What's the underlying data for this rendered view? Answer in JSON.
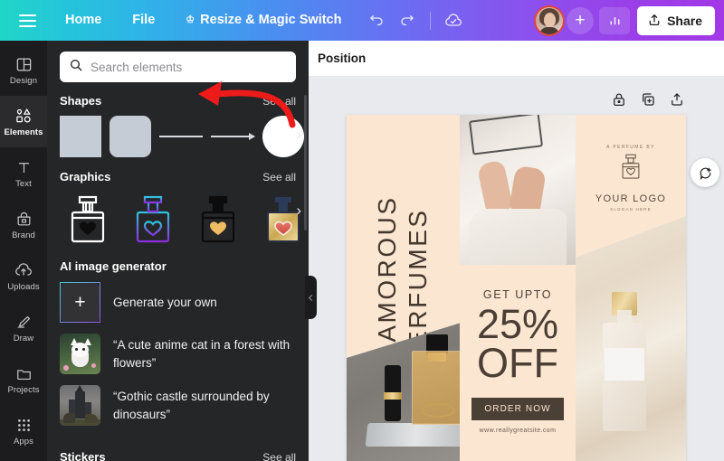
{
  "topbar": {
    "menu_icon": "hamburger-icon",
    "home_label": "Home",
    "file_label": "File",
    "resize_label": "Resize & Magic Switch",
    "crown_icon": "crown-icon",
    "undo_icon": "undo-icon",
    "redo_icon": "redo-icon",
    "cloud_icon": "cloud-saved-icon",
    "avatar_name": "user-avatar",
    "invite_label": "+",
    "stats_icon": "analytics-icon",
    "share_label": "Share",
    "share_icon": "share-upload-icon"
  },
  "sidebar": {
    "items": [
      {
        "label": "Design",
        "icon": "design-layout-icon",
        "active": false
      },
      {
        "label": "Elements",
        "icon": "elements-shapes-icon",
        "active": true
      },
      {
        "label": "Text",
        "icon": "text-t-icon",
        "active": false
      },
      {
        "label": "Brand",
        "icon": "brand-bag-icon",
        "active": false
      },
      {
        "label": "Uploads",
        "icon": "upload-cloud-icon",
        "active": false
      },
      {
        "label": "Draw",
        "icon": "draw-pen-icon",
        "active": false
      },
      {
        "label": "Projects",
        "icon": "folder-icon",
        "active": false
      },
      {
        "label": "Apps",
        "icon": "apps-grid-icon",
        "active": false
      }
    ]
  },
  "panel": {
    "search": {
      "placeholder": "Search elements",
      "icon": "search-icon"
    },
    "shapes": {
      "title": "Shapes",
      "see_all": "See all",
      "items": [
        "square-shape",
        "rounded-square-shape",
        "line-shape",
        "arrow-line-shape",
        "circle-shape"
      ],
      "next_icon": "chevron-right-icon"
    },
    "graphics": {
      "title": "Graphics",
      "see_all": "See all",
      "items": [
        "perfume-bottle-white",
        "perfume-bottle-gradient",
        "perfume-bottle-yellow",
        "perfume-bottle-gold"
      ]
    },
    "ai": {
      "title": "AI image generator",
      "generate_label": "Generate your own",
      "generate_icon": "plus-icon",
      "prompts": [
        {
          "text": "“A cute anime cat in a forest with flowers”",
          "thumb": "anime-cat-thumbnail"
        },
        {
          "text": "“Gothic castle surrounded by dinosaurs”",
          "thumb": "gothic-castle-thumbnail"
        }
      ]
    },
    "stickers": {
      "title": "Stickers",
      "see_all": "See all"
    },
    "collapse_icon": "chevron-left-icon"
  },
  "editor": {
    "position_label": "Position",
    "tools": [
      "lock-icon",
      "duplicate-page-icon",
      "add-page-icon"
    ],
    "comment_icon": "add-comment-icon"
  },
  "design": {
    "title": "GLAMOROUS PERFUMES",
    "logo": {
      "eyebrow": "A PERFUME BY",
      "name": "YOUR LOGO",
      "slogan": "SLOGAN HERE",
      "icon": "perfume-bottle-heart-icon"
    },
    "promo": {
      "eyebrow": "GET UPTO",
      "percent": "25%",
      "off": "OFF",
      "cta": "ORDER NOW",
      "website": "www.reallygreatsite.com"
    },
    "colors": {
      "cream": "#fbe6d2",
      "dark_brown": "#4b4035",
      "gold": "#d9b871"
    }
  },
  "annotation": {
    "type": "red-arrow",
    "color": "#ee1b1b"
  }
}
